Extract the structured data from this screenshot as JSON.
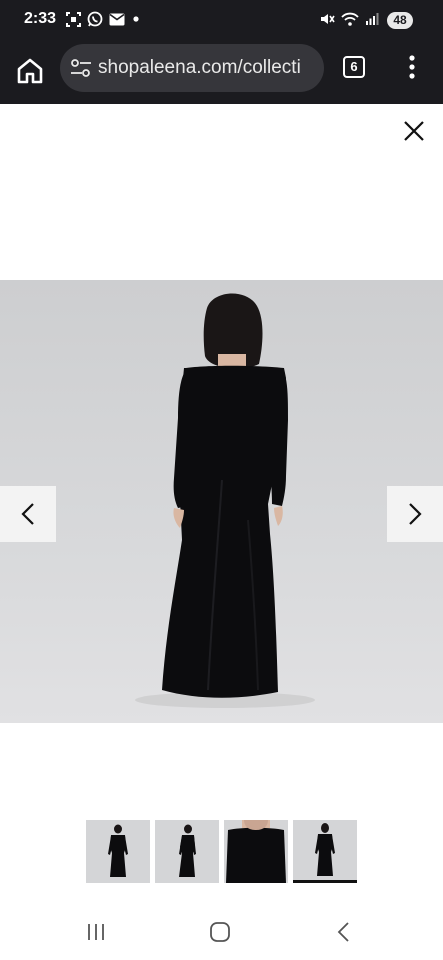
{
  "status_bar": {
    "time": "2:33",
    "battery": "48",
    "icons_left": [
      "screenshot-icon",
      "whatsapp-icon",
      "mail-icon",
      "dot-icon"
    ],
    "icons_right": [
      "mute-icon",
      "wifi-icon",
      "signal-icon"
    ]
  },
  "browser": {
    "url": "shopaleena.com/collecti",
    "tab_count": "6"
  },
  "gallery": {
    "image_description_name": "black-velvet-off-shoulder-gown-back-view",
    "thumbnail_count": 4,
    "active_thumbnail_index": 3
  },
  "colors": {
    "status_bg": "#1b1b1f",
    "url_pill": "#36363b",
    "dress": "#0c0c0e",
    "backdrop": "#d6d7d9"
  }
}
